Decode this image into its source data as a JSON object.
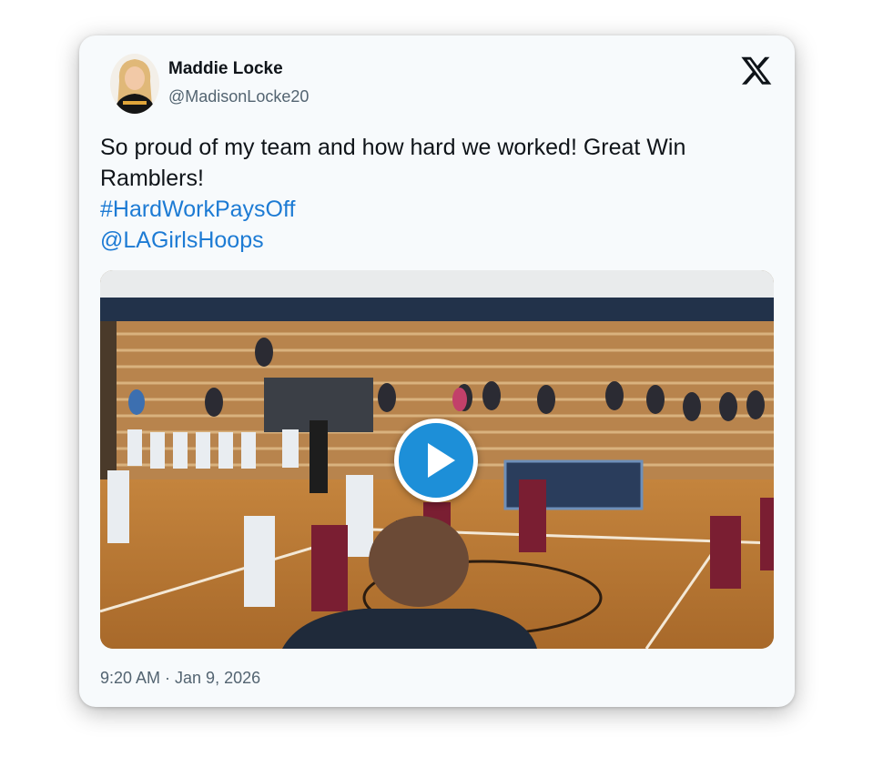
{
  "author": {
    "display_name": "Maddie Locke",
    "handle": "@MadisonLocke20"
  },
  "tweet": {
    "text": "So proud of my team and how hard we worked! Great Win Ramblers!",
    "hashtag": "#HardWorkPaysOff",
    "mention": "@LAGirlsHoops"
  },
  "meta": {
    "timestamp": "9:20 AM · Jan 9, 2026"
  },
  "icons": {
    "brand": "x-logo-icon",
    "media": "play-icon"
  },
  "colors": {
    "link": "#1d7bd4",
    "play_button": "#1d8fd8",
    "text": "#0f1419",
    "secondary_text": "#536471"
  }
}
